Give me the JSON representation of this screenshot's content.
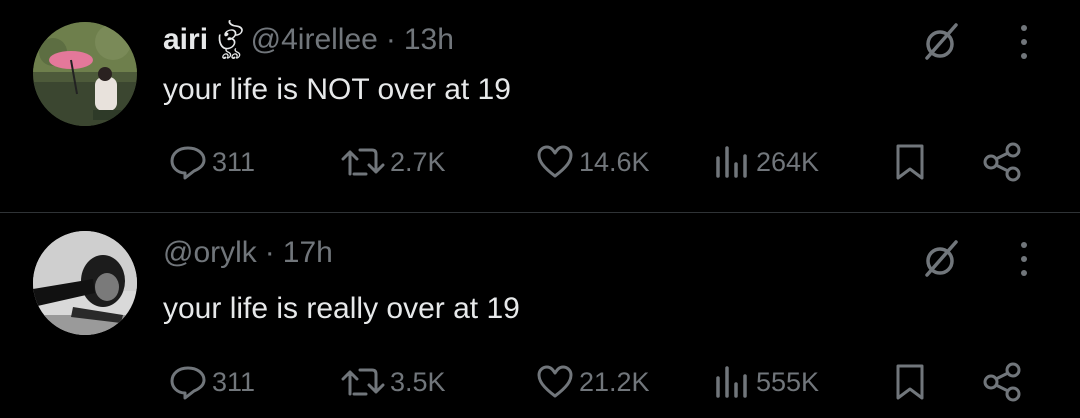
{
  "tweets": [
    {
      "display_name": "airi",
      "name_suffix": "ঔৣ",
      "handle": "@4irellee",
      "separator": "·",
      "time": "13h",
      "text": "your life is NOT over at 19",
      "replies": "311",
      "reposts": "2.7K",
      "likes": "14.6K",
      "views": "264K"
    },
    {
      "display_name": "",
      "name_suffix": "",
      "handle": "@orylk",
      "separator": "·",
      "time": "17h",
      "text": "your life is really over at 19",
      "replies": "311",
      "reposts": "3.5K",
      "likes": "21.2K",
      "views": "555K"
    }
  ],
  "icons": {
    "reply": "reply-icon",
    "repost": "repost-icon",
    "like": "heart-icon",
    "views": "views-icon",
    "bookmark": "bookmark-icon",
    "share": "share-icon",
    "grok": "grok-icon",
    "more": "more-icon"
  },
  "colors": {
    "background": "#000000",
    "text": "#e7e9ea",
    "muted": "#71767b",
    "divider": "#2f3336"
  }
}
